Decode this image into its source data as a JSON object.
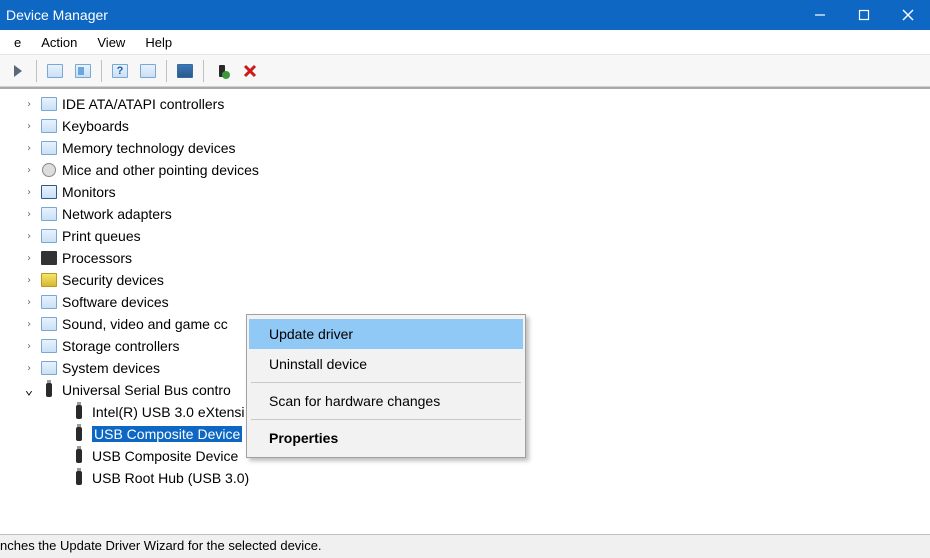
{
  "title": "Device Manager",
  "menu": {
    "file": "e",
    "action": "Action",
    "view": "View",
    "help": "Help"
  },
  "tree": {
    "items": [
      {
        "label": "IDE ATA/ATAPI controllers",
        "icon": "controller-icon",
        "expanded": false,
        "level": 1
      },
      {
        "label": "Keyboards",
        "icon": "keyboard-icon",
        "expanded": false,
        "level": 1
      },
      {
        "label": "Memory technology devices",
        "icon": "memory-icon",
        "expanded": false,
        "level": 1
      },
      {
        "label": "Mice and other pointing devices",
        "icon": "mouse-icon",
        "expanded": false,
        "level": 1
      },
      {
        "label": "Monitors",
        "icon": "monitor-icon",
        "expanded": false,
        "level": 1
      },
      {
        "label": "Network adapters",
        "icon": "network-icon",
        "expanded": false,
        "level": 1
      },
      {
        "label": "Print queues",
        "icon": "printer-icon",
        "expanded": false,
        "level": 1
      },
      {
        "label": "Processors",
        "icon": "processor-icon",
        "expanded": false,
        "level": 1
      },
      {
        "label": "Security devices",
        "icon": "security-icon",
        "expanded": false,
        "level": 1
      },
      {
        "label": "Software devices",
        "icon": "software-icon",
        "expanded": false,
        "level": 1
      },
      {
        "label": "Sound, video and game cc",
        "icon": "sound-icon",
        "expanded": false,
        "level": 1,
        "truncated": true
      },
      {
        "label": "Storage controllers",
        "icon": "storage-icon",
        "expanded": false,
        "level": 1
      },
      {
        "label": "System devices",
        "icon": "system-icon",
        "expanded": false,
        "level": 1
      },
      {
        "label": "Universal Serial Bus contro",
        "icon": "usb-controller-icon",
        "expanded": true,
        "level": 1,
        "truncated": true
      },
      {
        "label": "Intel(R) USB 3.0 eXtensi",
        "icon": "usb-icon",
        "expanded": null,
        "level": 2,
        "truncated": true
      },
      {
        "label": "USB Composite Device",
        "icon": "usb-icon",
        "expanded": null,
        "level": 2,
        "selected": true
      },
      {
        "label": "USB Composite Device",
        "icon": "usb-icon",
        "expanded": null,
        "level": 2
      },
      {
        "label": "USB Root Hub (USB 3.0)",
        "icon": "usb-icon",
        "expanded": null,
        "level": 2
      }
    ]
  },
  "context_menu": {
    "items": [
      {
        "label": "Update driver",
        "highlight": true
      },
      {
        "label": "Uninstall device"
      },
      {
        "sep": true
      },
      {
        "label": "Scan for hardware changes"
      },
      {
        "sep": true
      },
      {
        "label": "Properties",
        "bold": true
      }
    ]
  },
  "status": "nches the Update Driver Wizard for the selected device.",
  "toolbar_icons": [
    "forward-icon",
    "show-hidden-icon",
    "properties-icon",
    "help-icon",
    "update-driver-icon",
    "scan-icon",
    "uninstall-icon",
    "enable-icon",
    "disable-icon"
  ]
}
